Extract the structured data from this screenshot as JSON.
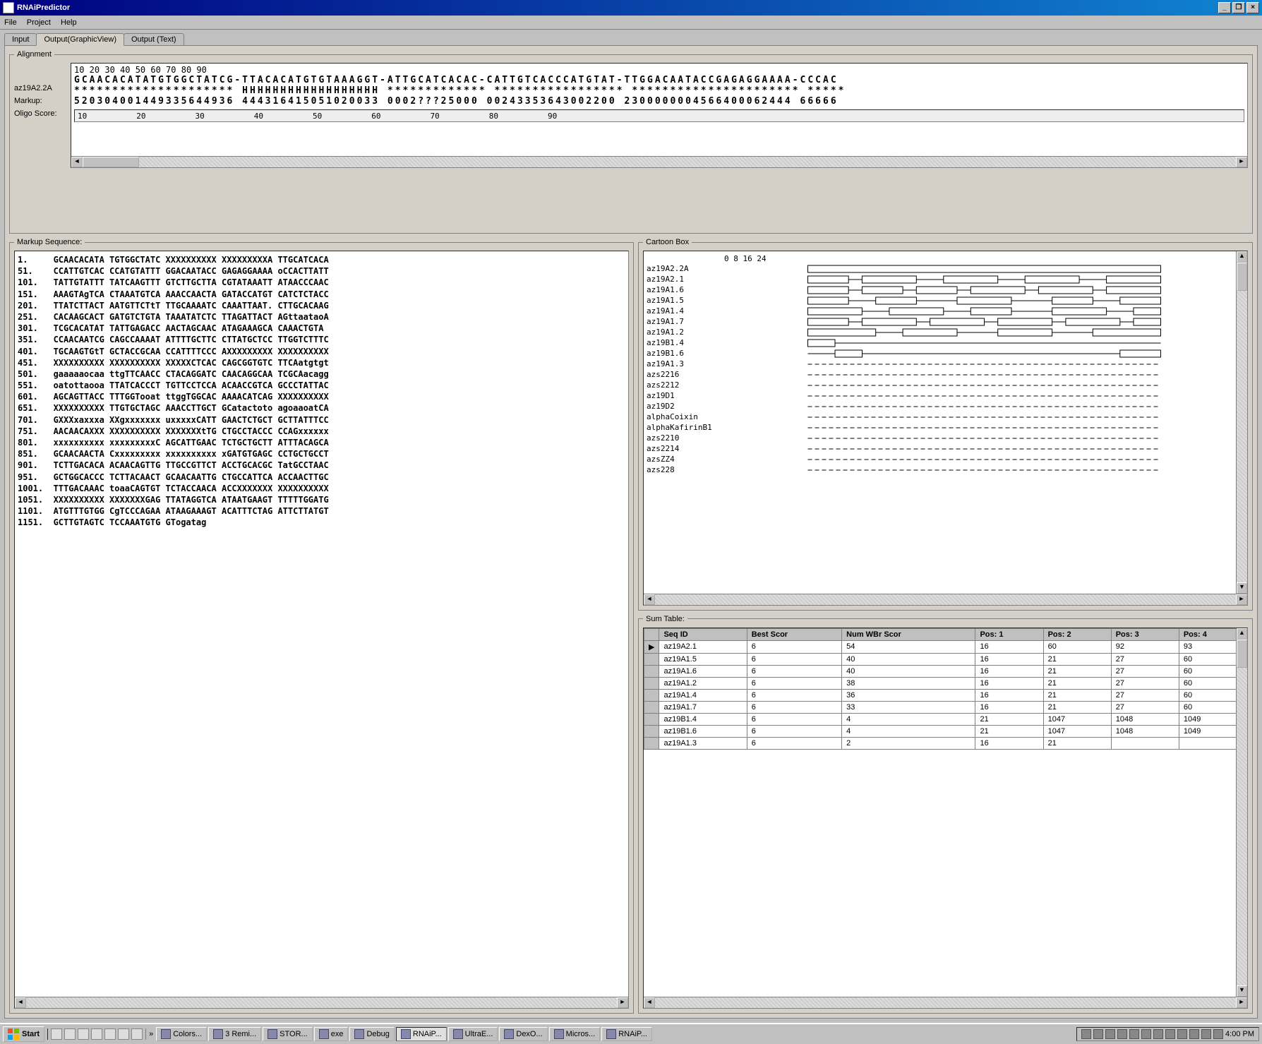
{
  "window": {
    "title": "RNAiPredictor",
    "min_label": "_",
    "max_label": "❐",
    "close_label": "×"
  },
  "menu": {
    "file": "File",
    "project": "Project",
    "help": "Help"
  },
  "tabs": {
    "input": "Input",
    "output_graphic": "Output(GraphicView)",
    "output_text": "Output (Text)"
  },
  "alignment": {
    "legend": "Alignment",
    "row_labels": [
      "az19A2.2A",
      "Markup:",
      "Oligo Score:"
    ],
    "ruler_ticks": [
      "10",
      "20",
      "30",
      "40",
      "50",
      "60",
      "70",
      "80",
      "90"
    ],
    "subruler_ticks": [
      "10",
      "20",
      "30",
      "40",
      "50",
      "60",
      "70",
      "80",
      "90"
    ],
    "seq": "GCAACACATATGTGGCTATCG-TTACACATGTGTAAAGGT-ATTGCATCACAC-CATTGTCACCCATGTAT-TTGGACAATACCGAGAGGAAAA-CCCAC",
    "markup": "********************* HHHHHHHHHHHHHHHHHH ************* ***************** ********************** *****",
    "score": "520304001449335644936 444316415051020033 0002???25000 00243353643002200 2300000004566400062444 66666"
  },
  "markup_seq": {
    "legend": "Markup Sequence:",
    "lines": [
      {
        "pos": "1",
        "seq": "GCAACACATA TGTGGCTATC XXXXXXXXXX XXXXXXXXXA TTGCATCACA"
      },
      {
        "pos": "51",
        "seq": "CCATTGTCAC CCATGTATTT GGACAATACC GAGAGGAAAA oCCACTTATT"
      },
      {
        "pos": "101",
        "seq": "TATTGTATTT TATCAAGTTT GTCTTGCTTA CGTATAAATT ATAACCCAAC"
      },
      {
        "pos": "151",
        "seq": "AAAGTAgTCA CTAAATGTCA AAACCAACTA GATACCATGT CATCTCTACC"
      },
      {
        "pos": "201",
        "seq": "TTATCTTACT AATGTTCTtT TTGCAAAATC CAAATTAAT. CTTGCACAAG"
      },
      {
        "pos": "251",
        "seq": "CACAAGCACT GATGTCTGTA TAAATATCTC TTAGATTACT AGttaataoA"
      },
      {
        "pos": "301",
        "seq": "TCGCACATAT TATTGAGACC AACTAGCAAC ATAGAAAGCA CAAACTGTA"
      },
      {
        "pos": "351",
        "seq": "CCAACAATCG CAGCCAAAAT ATTTTGCTTC CTTATGCTCC TTGGTCTTTC"
      },
      {
        "pos": "401",
        "seq": "TGCAAGTGtT GCTACCGCAA CCATTTTCCC AXXXXXXXXX XXXXXXXXXX"
      },
      {
        "pos": "451",
        "seq": "XXXXXXXXXX XXXXXXXXXX XXXXXCTCAC CAGCGGTGTC TTCAatgtgt"
      },
      {
        "pos": "501",
        "seq": "gaaaaaocaa ttgTTCAACC CTACAGGATC CAACAGGCAA TCGCAacagg"
      },
      {
        "pos": "551",
        "seq": "oatottaooa TTATCACCCT TGTTCCTCCA ACAACCGTCA GCCCTATTAC"
      },
      {
        "pos": "601",
        "seq": "AGCAGTTACC TTTGGTooat ttggTGGCAC AAAACATCAG XXXXXXXXXX"
      },
      {
        "pos": "651",
        "seq": "XXXXXXXXXX TTGTGCTAGC AAACCTTGCT GCatactoto agoaaoatCA"
      },
      {
        "pos": "701",
        "seq": "GXXXxaxxxa XXgxxxxxxx uxxxxxCATT GAACTCTGCT GCTTATTTCC"
      },
      {
        "pos": "751",
        "seq": "AACAACAXXX XXXXXXXXXX XXXXXXXtTG CTGCCTACCC CCAGxxxxxx"
      },
      {
        "pos": "801",
        "seq": "xxxxxxxxxx xxxxxxxxxC AGCATTGAAC TCTGCTGCTT ATTTACAGCA"
      },
      {
        "pos": "851",
        "seq": "GCAACAACTA Cxxxxxxxxx xxxxxxxxxx xGATGTGAGC CCTGCTGCCT"
      },
      {
        "pos": "901",
        "seq": "TCTTGACACA ACAACAGTTG TTGCCGTTCT ACCTGCACGC TatGCCTAAC"
      },
      {
        "pos": "951",
        "seq": "GCTGGCACCC TCTTACAACT GCAACAATTG CTGCCATTCA ACCAACTTGC"
      },
      {
        "pos": "1001",
        "seq": "TTTGACAAAC toaaCAGTGT TCTACCAACA ACCXXXXXXX XXXXXXXXXX"
      },
      {
        "pos": "1051",
        "seq": "XXXXXXXXXX XXXXXXXGAG TTATAGGTCA ATAATGAAGT TTTTTGGATG"
      },
      {
        "pos": "1101",
        "seq": "ATGTTTGTGG CgTCCCAGAA ATAAGAAAGT ACATTTCTAG ATTCTTATGT"
      },
      {
        "pos": "1151",
        "seq": "GCTTGTAGTC TCCAAATGTG GTogatag"
      }
    ]
  },
  "cartoon": {
    "legend": "Cartoon Box",
    "ruler": [
      "0",
      "8",
      "16",
      "24"
    ],
    "rows": [
      {
        "id": "az19A2.2A",
        "exons": [
          [
            0,
            26
          ]
        ]
      },
      {
        "id": "az19A2.1",
        "exons": [
          [
            0,
            3
          ],
          [
            4,
            8
          ],
          [
            10,
            14
          ],
          [
            16,
            20
          ],
          [
            22,
            26
          ]
        ]
      },
      {
        "id": "az19A1.6",
        "exons": [
          [
            0,
            3
          ],
          [
            4,
            7
          ],
          [
            8,
            11
          ],
          [
            12,
            16
          ],
          [
            17,
            21
          ],
          [
            22,
            26
          ]
        ]
      },
      {
        "id": "az19A1.5",
        "exons": [
          [
            0,
            3
          ],
          [
            5,
            8
          ],
          [
            11,
            15
          ],
          [
            18,
            21
          ],
          [
            23,
            26
          ]
        ]
      },
      {
        "id": "az19A1.4",
        "exons": [
          [
            0,
            4
          ],
          [
            6,
            10
          ],
          [
            12,
            15
          ],
          [
            18,
            22
          ],
          [
            24,
            26
          ]
        ]
      },
      {
        "id": "az19A1.7",
        "exons": [
          [
            0,
            3
          ],
          [
            4,
            8
          ],
          [
            9,
            13
          ],
          [
            14,
            18
          ],
          [
            19,
            23
          ],
          [
            24,
            26
          ]
        ]
      },
      {
        "id": "az19A1.2",
        "exons": [
          [
            0,
            5
          ],
          [
            7,
            11
          ],
          [
            14,
            18
          ],
          [
            21,
            26
          ]
        ]
      },
      {
        "id": "az19B1.4",
        "exons": [
          [
            0,
            2
          ]
        ]
      },
      {
        "id": "az19B1.6",
        "exons": [
          [
            2,
            4
          ],
          [
            23,
            26
          ]
        ]
      },
      {
        "id": "az19A1.3",
        "exons": []
      },
      {
        "id": "azs2216",
        "exons": []
      },
      {
        "id": "azs2212",
        "exons": []
      },
      {
        "id": "az19D1",
        "exons": []
      },
      {
        "id": "az19D2",
        "exons": []
      },
      {
        "id": "alphaCoixin",
        "exons": []
      },
      {
        "id": "alphaKafirinB1",
        "exons": []
      },
      {
        "id": "azs2210",
        "exons": []
      },
      {
        "id": "azs2214",
        "exons": []
      },
      {
        "id": "azsZZ4",
        "exons": []
      },
      {
        "id": "azs228",
        "exons": []
      }
    ]
  },
  "sum": {
    "legend": "Sum Table:",
    "headers": [
      "",
      "Seq ID",
      "Best Scor",
      "Num WBr Scor",
      "Pos: 1",
      "Pos: 2",
      "Pos: 3",
      "Pos: 4"
    ],
    "rows": [
      {
        "marker": "▶",
        "id": "az19A2.1",
        "best": "6",
        "num": "54",
        "p1": "16",
        "p2": "60",
        "p3": "92",
        "p4": "93"
      },
      {
        "marker": "",
        "id": "az19A1.5",
        "best": "6",
        "num": "40",
        "p1": "16",
        "p2": "21",
        "p3": "27",
        "p4": "60"
      },
      {
        "marker": "",
        "id": "az19A1.6",
        "best": "6",
        "num": "40",
        "p1": "16",
        "p2": "21",
        "p3": "27",
        "p4": "60"
      },
      {
        "marker": "",
        "id": "az19A1.2",
        "best": "6",
        "num": "38",
        "p1": "16",
        "p2": "21",
        "p3": "27",
        "p4": "60"
      },
      {
        "marker": "",
        "id": "az19A1.4",
        "best": "6",
        "num": "36",
        "p1": "16",
        "p2": "21",
        "p3": "27",
        "p4": "60"
      },
      {
        "marker": "",
        "id": "az19A1.7",
        "best": "6",
        "num": "33",
        "p1": "16",
        "p2": "21",
        "p3": "27",
        "p4": "60"
      },
      {
        "marker": "",
        "id": "az19B1.4",
        "best": "6",
        "num": "4",
        "p1": "21",
        "p2": "1047",
        "p3": "1048",
        "p4": "1049"
      },
      {
        "marker": "",
        "id": "az19B1.6",
        "best": "6",
        "num": "4",
        "p1": "21",
        "p2": "1047",
        "p3": "1048",
        "p4": "1049"
      },
      {
        "marker": "",
        "id": "az19A1.3",
        "best": "6",
        "num": "2",
        "p1": "16",
        "p2": "21",
        "p3": "",
        "p4": ""
      }
    ]
  },
  "taskbar": {
    "start": "Start",
    "buttons": [
      {
        "label": "Colors..."
      },
      {
        "label": "3 Remi..."
      },
      {
        "label": "STOR..."
      },
      {
        "label": "exe"
      },
      {
        "label": "Debug"
      },
      {
        "label": "RNAiP...",
        "active": true
      },
      {
        "label": "UltraE..."
      },
      {
        "label": "DexO..."
      },
      {
        "label": "Micros..."
      },
      {
        "label": "RNAiP..."
      }
    ],
    "clock": "4:00 PM"
  }
}
